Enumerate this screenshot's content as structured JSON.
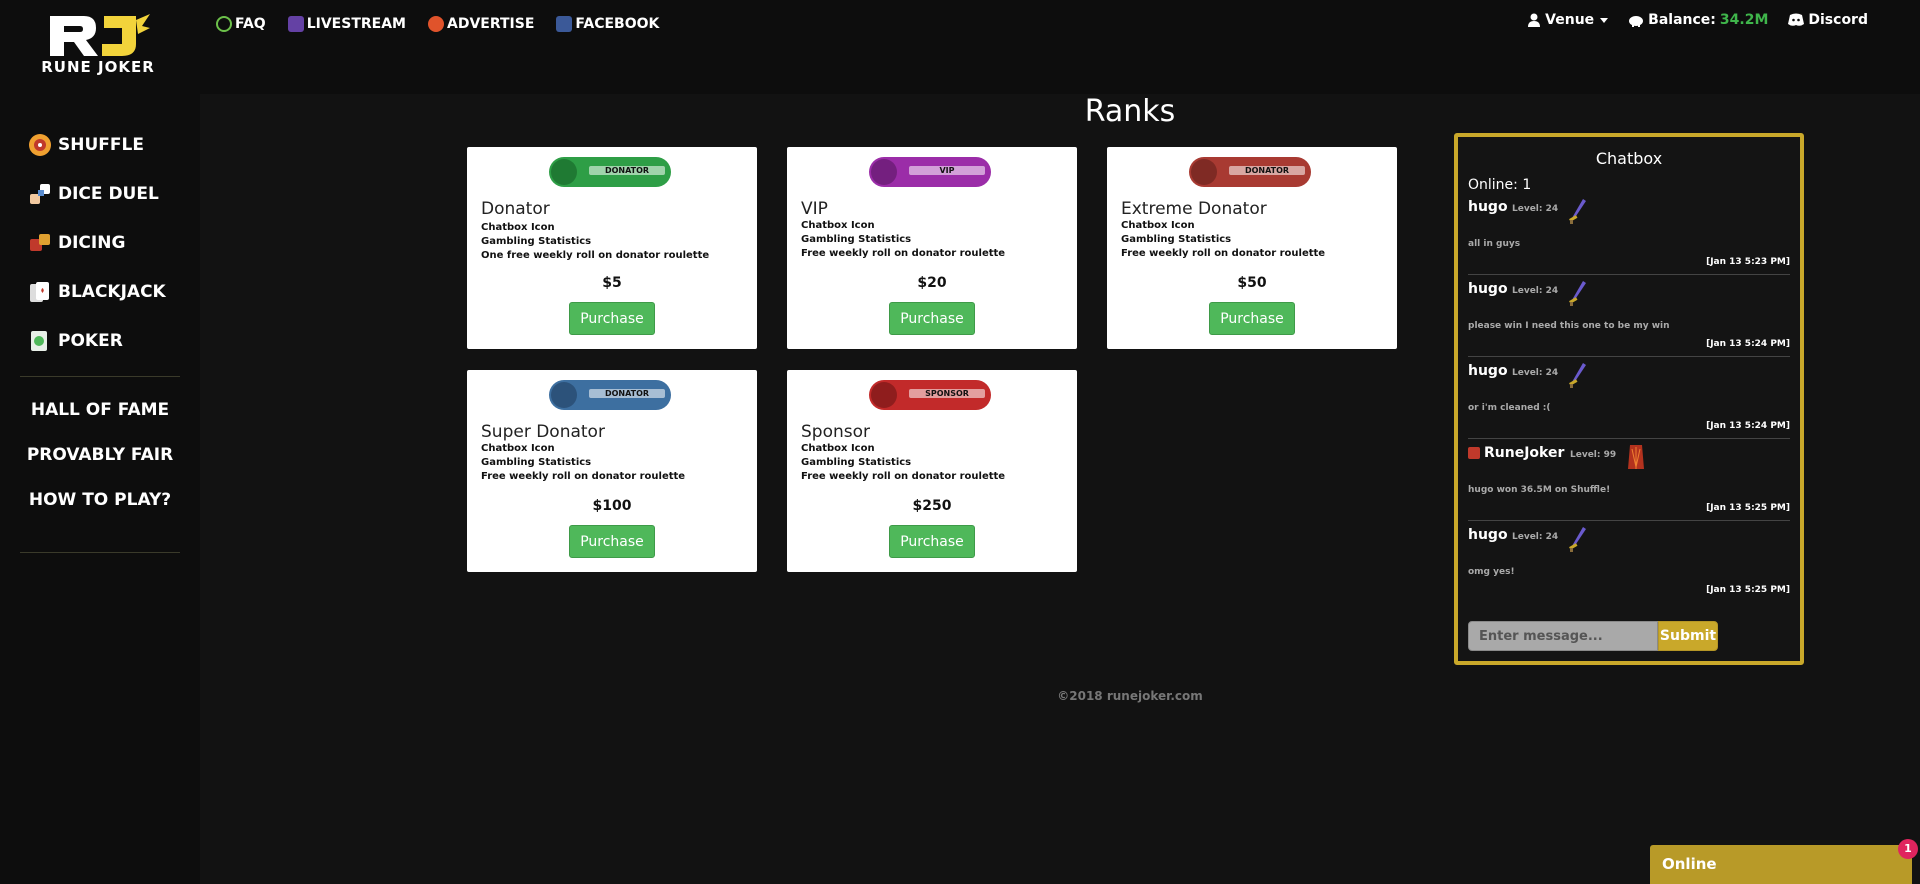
{
  "logo": {
    "text": "RUNE JOKER"
  },
  "topnav": [
    {
      "label": "FAQ",
      "icon": "faq-icon",
      "color": "#6cc04a"
    },
    {
      "label": "LIVESTREAM",
      "icon": "twitch-icon",
      "color": "#6441a4"
    },
    {
      "label": "ADVERTISE",
      "icon": "advertise-icon",
      "color": "#e0532b"
    },
    {
      "label": "FACEBOOK",
      "icon": "facebook-icon",
      "color": "#3b5998"
    }
  ],
  "user": {
    "name": "Venue",
    "balance_label": "Balance:",
    "balance_value": "34.2M",
    "discord_label": "Discord"
  },
  "sidebar": {
    "games": [
      {
        "label": "SHUFFLE",
        "icon": "shuffle-wheel-icon"
      },
      {
        "label": "DICE DUEL",
        "icon": "dice-duel-icon"
      },
      {
        "label": "DICING",
        "icon": "dice-icon"
      },
      {
        "label": "BLACKJACK",
        "icon": "cards-icon"
      },
      {
        "label": "POKER",
        "icon": "poker-card-icon"
      }
    ],
    "links": [
      "HALL OF FAME",
      "PROVABLY FAIR",
      "HOW TO PLAY?"
    ]
  },
  "page": {
    "title": "Ranks",
    "footer": "©2018 runejoker.com"
  },
  "ranks": [
    {
      "title": "Donator",
      "badge": "DONATOR",
      "color": "#2e9e46",
      "features": [
        "Chatbox Icon",
        "Gambling Statistics",
        "One free weekly roll on donator roulette"
      ],
      "price": "$5",
      "button": "Purchase"
    },
    {
      "title": "VIP",
      "badge": "VIP",
      "color": "#9b2da8",
      "features": [
        "Chatbox Icon",
        "Gambling Statistics",
        "Free weekly roll on donator roulette"
      ],
      "price": "$20",
      "button": "Purchase"
    },
    {
      "title": "Extreme Donator",
      "badge": "DONATOR",
      "color": "#a83a32",
      "features": [
        "Chatbox Icon",
        "Gambling Statistics",
        "Free weekly roll on donator roulette"
      ],
      "price": "$50",
      "button": "Purchase"
    },
    {
      "title": "Super Donator",
      "badge": "DONATOR",
      "color": "#3d6fa0",
      "features": [
        "Chatbox Icon",
        "Gambling Statistics",
        "Free weekly roll on donator roulette"
      ],
      "price": "$100",
      "button": "Purchase"
    },
    {
      "title": "Sponsor",
      "badge": "SPONSOR",
      "color": "#c22a2a",
      "features": [
        "Chatbox Icon",
        "Gambling Statistics",
        "Free weekly roll on donator roulette"
      ],
      "price": "$250",
      "button": "Purchase"
    }
  ],
  "chat": {
    "title": "Chatbox",
    "online": "Online: 1",
    "messages": [
      {
        "user": "hugo",
        "level": "Level: 24",
        "text": "all in guys",
        "time": "[Jan 13 5:23 PM]"
      },
      {
        "user": "hugo",
        "level": "Level: 24",
        "text": "please win I need this one to be my win",
        "time": "[Jan 13 5:24 PM]"
      },
      {
        "user": "hugo",
        "level": "Level: 24",
        "text": "or i'm cleaned :(",
        "time": "[Jan 13 5:24 PM]"
      },
      {
        "user": "RuneJoker",
        "level": "Level: 99",
        "text": "hugo won 36.5M on Shuffle!",
        "time": "[Jan 13 5:25 PM]"
      },
      {
        "user": "hugo",
        "level": "Level: 24",
        "text": "omg yes!",
        "time": "[Jan 13 5:25 PM]"
      }
    ],
    "input_placeholder": "Enter message...",
    "submit": "Submit"
  },
  "online_tab": {
    "label": "Online",
    "count": "1"
  },
  "colors": {
    "accent_gold": "#c9a82a",
    "green": "#4fb85a",
    "balance_green": "#3fb54b"
  }
}
